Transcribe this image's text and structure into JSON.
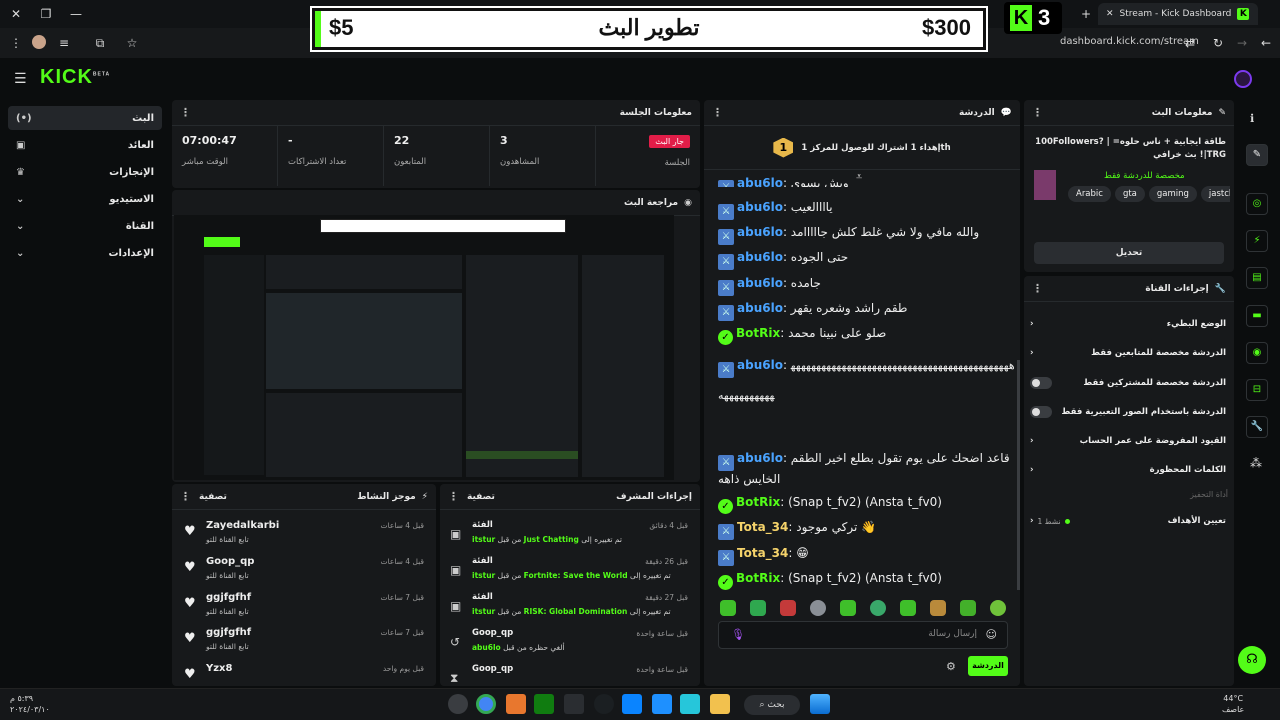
{
  "browser": {
    "tab_title": "Stream - Kick Dashboard",
    "url": "dashboard.kick.com/stream"
  },
  "overlay": {
    "low_amount": "$5",
    "goal_title": "تطوير البث",
    "high_amount": "$300",
    "kick_count": "3"
  },
  "app": {
    "logo": "KICK",
    "logo_badge": "BETA"
  },
  "nav": [
    {
      "label": "البث",
      "icon": "broadcast-icon"
    },
    {
      "label": "العائد",
      "icon": "money-icon"
    },
    {
      "label": "الإنجازات",
      "icon": "trophy-icon"
    },
    {
      "label": "الاستيديو",
      "icon": "studio-icon"
    },
    {
      "label": "القناة",
      "icon": "channel-icon"
    },
    {
      "label": "الإعدادات",
      "icon": "gear-icon"
    }
  ],
  "session": {
    "title": "معلومات الجلسة",
    "live_badge": "جار البث",
    "session_label": "الجلسة",
    "viewers_value": "3",
    "viewers_label": "المشاهدون",
    "followers_value": "22",
    "followers_label": "المتابعون",
    "subs_value": "-",
    "subs_label": "تعداد الاشتراكات",
    "uptime_value": "07:00:47",
    "uptime_label": "الوقت مباشر"
  },
  "preview": {
    "title": "مراجعة البث"
  },
  "activity": {
    "title": "موجز النشاط",
    "filter": "تصفية",
    "items": [
      {
        "name": "Zayedalkarbi",
        "sub": "تابع القناة للتو",
        "time": "قبل 4 ساعات"
      },
      {
        "name": "Goop_qp",
        "sub": "تابع القناة للتو",
        "time": "قبل 4 ساعات"
      },
      {
        "name": "ggjfgfhf",
        "sub": "تابع القناة للتو",
        "time": "قبل 7 ساعات"
      },
      {
        "name": "ggjfgfhf",
        "sub": "تابع القناة للتو",
        "time": "قبل 7 ساعات"
      },
      {
        "name": "Yzx8",
        "sub": "",
        "time": "قبل يوم واحد"
      }
    ]
  },
  "mod": {
    "title": "إجراءات المشرف",
    "filter": "تصفية",
    "items": [
      {
        "title": "الفئة",
        "desc_pre": "تم تغييره إلى",
        "target": "Just Chatting",
        "desc_mid": "من قبل",
        "user": "itstur",
        "time": "قبل 4 دقائق",
        "icon": "category-icon"
      },
      {
        "title": "الفئة",
        "desc_pre": "تم تغييره إلى",
        "target": "Fortnite: Save the World",
        "desc_mid": "من قبل",
        "user": "itstur",
        "time": "قبل 26 دقيقة",
        "icon": "category-icon"
      },
      {
        "title": "الفئة",
        "desc_pre": "تم تغييره إلى",
        "target": "RISK: Global Domination",
        "desc_mid": "من قبل",
        "user": "itstur",
        "time": "قبل 27 دقيقة",
        "icon": "category-icon"
      },
      {
        "title": "Goop_qp",
        "desc_pre": "ألغي حظره من قبل",
        "target": "",
        "desc_mid": "",
        "user": "abu6lo",
        "time": "قبل ساعة واحدة",
        "icon": "unban-icon"
      },
      {
        "title": "Goop_qp",
        "desc_pre": "",
        "target": "",
        "desc_mid": "",
        "user": "",
        "time": "قبل ساعة واحدة",
        "icon": "timeout-icon"
      }
    ]
  },
  "chat": {
    "title": "الدردشة",
    "pinned": "إهداء 1 اشتراك للوصول للمركز 1th",
    "pinned_rank": "1",
    "messages": [
      {
        "user": "abu6lo",
        "text": "ويش يسوي",
        "type": "mod"
      },
      {
        "user": "abu6lo",
        "text": "ياااالعيب",
        "type": "mod"
      },
      {
        "user": "abu6lo",
        "text": "والله مافي ولا شي غلط كلش جااااامد",
        "type": "mod"
      },
      {
        "user": "abu6lo",
        "text": "حتى الجوده",
        "type": "mod"
      },
      {
        "user": "abu6lo",
        "text": "جامده",
        "type": "mod"
      },
      {
        "user": "abu6lo",
        "text": "طقم راشد وشعره يقهر",
        "type": "mod"
      },
      {
        "user": "BotRix",
        "text": "صلو على نبينا محمد",
        "type": "bot"
      },
      {
        "user": "abu6lo",
        "text": "ههههههههههههههههههههههههههههههههههههههههههههههههههههههه",
        "type": "mod"
      },
      {
        "user": "abu6lo",
        "text": "قاعد اضحك على يوم تقول بطلع اخير الطقم الخايس ذاهه",
        "type": "mod"
      },
      {
        "user": "BotRix",
        "text": "(Snap t_fv2) (Ansta t_fv0)",
        "type": "bot"
      },
      {
        "user": "Tota_34",
        "text": "تركي موجود 👋",
        "type": "user"
      },
      {
        "user": "Tota_34",
        "text": "😁",
        "type": "user"
      },
      {
        "user": "BotRix",
        "text": "(Snap t_fv2) (Ansta t_fv0)",
        "type": "bot"
      }
    ],
    "input_placeholder": "إرسال رسالة",
    "send_label": "الدردشة"
  },
  "stream_info": {
    "title": "معلومات البث",
    "stream_title": "طاقة ايجابية + ناس حلوه= | 100Followers? |TRG! بث خرافي",
    "category": "مخصصة للدردشة فقط",
    "tags": [
      "Arabic",
      "gta",
      "gaming",
      "jastchatting"
    ],
    "edit_label": "تحديل"
  },
  "channel_actions": {
    "title": "إجراءات القناة",
    "items": [
      {
        "label": "الوضع البطيء",
        "control": "chevron"
      },
      {
        "label": "الدردشة مخصصة للمتابعين فقط",
        "control": "chevron"
      },
      {
        "label": "الدردشة مخصصة للمشتركين فقط",
        "control": "toggle"
      },
      {
        "label": "الدردشة باستخدام الصور التعبيرية فقط",
        "control": "toggle"
      },
      {
        "label": "القيود المفروضة على عمر الحساب",
        "control": "chevron"
      },
      {
        "label": "الكلمات المحظورة",
        "control": "chevron"
      }
    ],
    "section_label": "أداة التحفيز",
    "goal_label": "تعيين الأهداف",
    "goal_status": "نشط 1"
  },
  "taskbar": {
    "search": "بحث",
    "clock_time": "٥:٣٩ م",
    "clock_date": "٢٠٢٤/٠٣/١٠",
    "weather_temp": "44°C",
    "weather_desc": "عاصف"
  }
}
